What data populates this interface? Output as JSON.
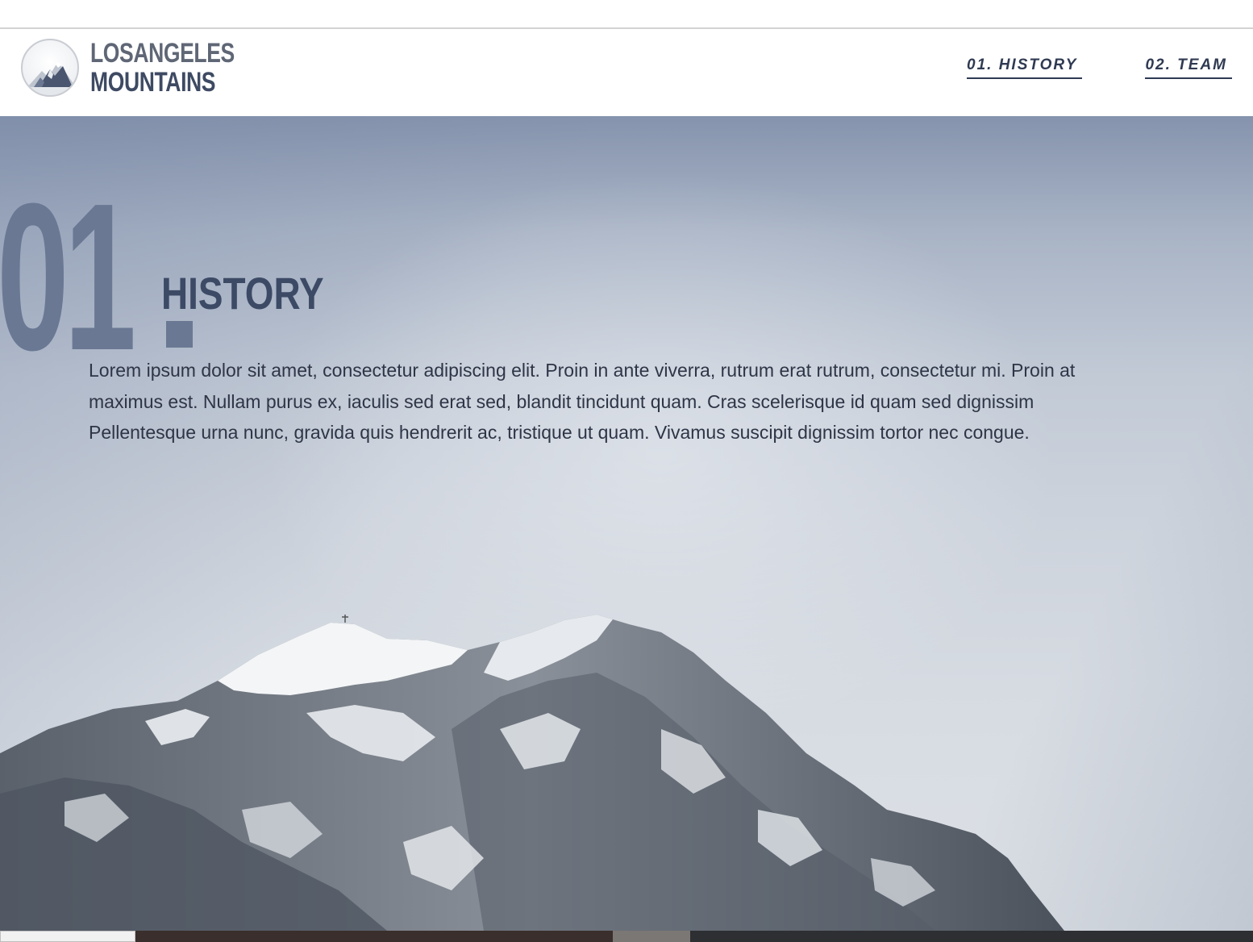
{
  "brand": {
    "line1": "LOSANGELES",
    "line2": "MOUNTAINS",
    "logo_icon": "mountain-logo-icon"
  },
  "nav": {
    "items": [
      {
        "label": "01. HISTORY"
      },
      {
        "label": "02. TEAM"
      }
    ]
  },
  "section": {
    "number": "01",
    "title": "HISTORY",
    "body": "Lorem ipsum dolor sit amet, consectetur adipiscing elit. Proin in ante viverra, rutrum erat rutrum, consectetur mi. Proin at maximus est. Nullam purus ex, iaculis sed erat sed, blandit tincidunt quam. Cras scelerisque id quam sed dignissim Pellentesque urna nunc, gravida quis hendrerit ac, tristique ut quam. Vivamus suscipit dignissim tortor nec congue."
  },
  "colors": {
    "accent": "#2f3a52",
    "number": "#6a7893",
    "title": "#3d4a66"
  }
}
